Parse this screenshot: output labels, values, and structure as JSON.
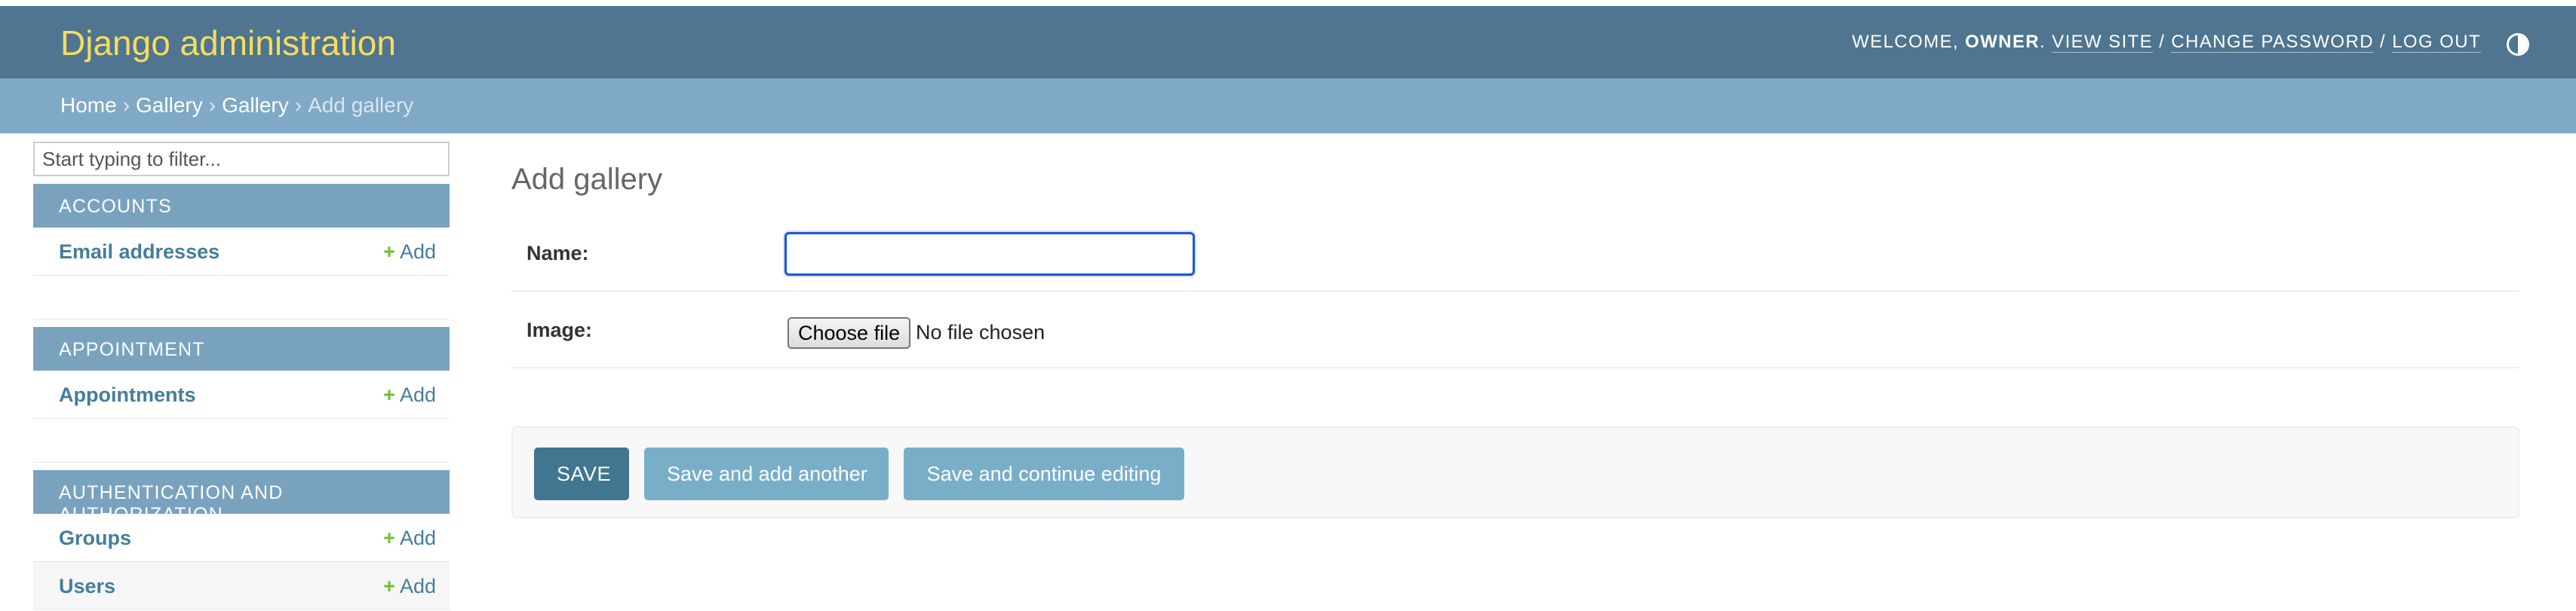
{
  "header": {
    "brand": "Django administration",
    "welcome": "Welcome,",
    "username": "owner",
    "view_site": "View site",
    "change_password": "Change password",
    "log_out": "Log out",
    "separator": "/",
    "theme_icon": "contrast-toggle-icon"
  },
  "breadcrumbs": {
    "items": [
      "Home",
      "Gallery",
      "Gallery"
    ],
    "current": "Add gallery",
    "separator": "›"
  },
  "sidebar": {
    "filter_placeholder": "Start typing to filter...",
    "add_label": "Add",
    "modules": [
      {
        "caption": "Accounts",
        "models": [
          "Email addresses"
        ]
      },
      {
        "caption": "Appointment",
        "models": [
          "Appointments"
        ]
      },
      {
        "caption": "Authentication and Authorization",
        "models": [
          "Groups",
          "Users"
        ]
      }
    ]
  },
  "main": {
    "title": "Add gallery",
    "fields": {
      "name_label": "Name:",
      "name_value": "",
      "image_label": "Image:",
      "choose_file": "Choose file",
      "file_status": "No file chosen"
    },
    "buttons": {
      "save": "Save",
      "save_add_another": "Save and add another",
      "save_continue": "Save and continue editing"
    }
  },
  "colors": {
    "header_bg": "#4f7590",
    "brand": "#f5dd5d",
    "breadcrumbs_bg": "#7fa9c6",
    "module_caption_bg": "#79a2bf",
    "link": "#447e9b",
    "add_plus": "#70bf2b",
    "save_button": "#417690",
    "secondary_button": "#79aec8",
    "focus_border": "#1e56d6"
  }
}
